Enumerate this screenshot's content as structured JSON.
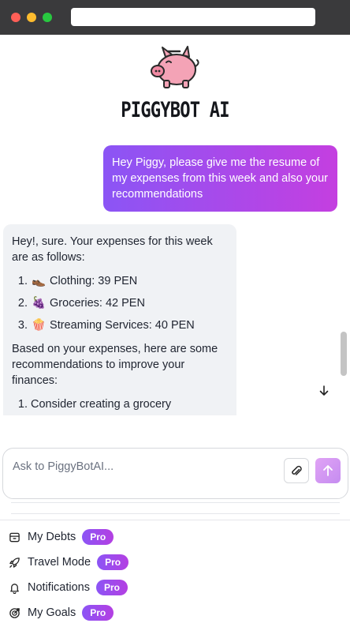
{
  "browser": {
    "url": ""
  },
  "header": {
    "brand": "PIGGYBOT AI",
    "logo_icon": "piggy-bank-icon"
  },
  "chat": {
    "user_message": "Hey Piggy, please give me the resume of my expenses from this week and also your recommendations",
    "bot_intro": "Hey!, sure. Your expenses for this week are as follows:",
    "expenses": [
      {
        "emoji": "👞",
        "text": "Clothing: 39 PEN"
      },
      {
        "emoji": "🍇",
        "text": "Groceries: 42 PEN"
      },
      {
        "emoji": "🍿",
        "text": "Streaming Services: 40 PEN"
      }
    ],
    "recommendations_intro": "Based on your expenses, here are some recommendations to improve your finances:",
    "recommendations": [
      "Consider creating a grocery"
    ],
    "scroll_down_icon": "arrow-down-icon"
  },
  "composer": {
    "placeholder": "Ask to PiggyBotAI...",
    "value": "",
    "attach_icon": "paperclip-icon",
    "send_icon": "arrow-up-icon"
  },
  "menu": {
    "badge": "Pro",
    "items": [
      {
        "label": "My Debts",
        "icon": "archive-box-icon"
      },
      {
        "label": "Travel Mode",
        "icon": "rocket-icon"
      },
      {
        "label": "Notifications",
        "icon": "bell-icon"
      },
      {
        "label": "My Goals",
        "icon": "target-icon"
      }
    ]
  },
  "colors": {
    "accent_start": "#8b55f5",
    "accent_end": "#c43fe0",
    "bot_bubble": "#f0f2f5",
    "chrome": "#3a3a3c"
  }
}
